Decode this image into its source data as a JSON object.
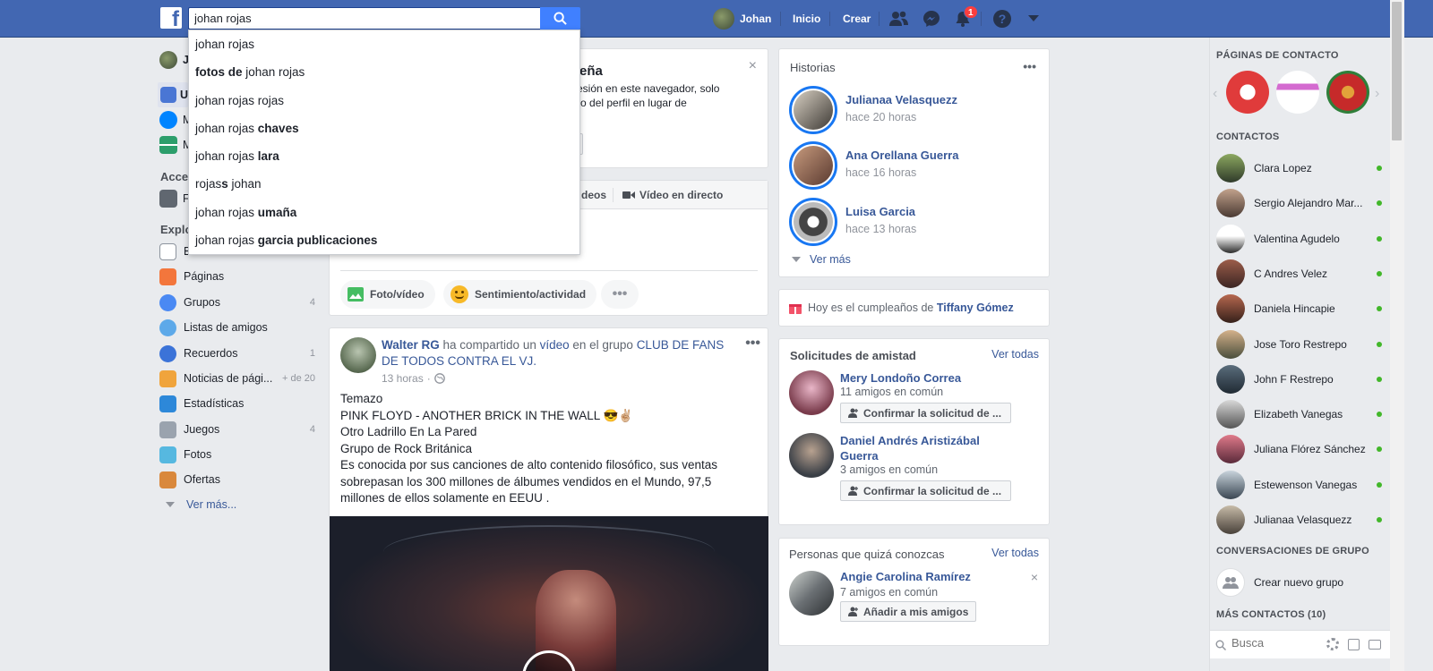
{
  "header": {
    "logo": "f",
    "search_value": "johan rojas",
    "user_name": "Johan",
    "home": "Inicio",
    "create": "Crear",
    "notif_count": "1"
  },
  "suggestions": [
    {
      "pre": "johan rojas",
      "bold": ""
    },
    {
      "pre": "",
      "bold": "fotos de",
      "post": " johan rojas"
    },
    {
      "pre": "johan rojas rojas",
      "bold": ""
    },
    {
      "pre": "johan rojas ",
      "bold": "chaves"
    },
    {
      "pre": "johan rojas ",
      "bold": "lara"
    },
    {
      "pre": "rojas",
      "bold": "s",
      "post": " johan"
    },
    {
      "pre": "johan rojas ",
      "bold": "umaña"
    },
    {
      "pre": "johan rojas ",
      "bold": "garcia publicaciones"
    }
  ],
  "left": {
    "user_initial": "J",
    "partial_u": "U",
    "partial_m1": "M",
    "partial_m2": "M",
    "shortcuts_head": "Acce",
    "partial_f": "F",
    "explore_head": "Explo",
    "items": [
      {
        "label": "Eventos",
        "count": ""
      },
      {
        "label": "Páginas",
        "count": ""
      },
      {
        "label": "Grupos",
        "count": "4"
      },
      {
        "label": "Listas de amigos",
        "count": ""
      },
      {
        "label": "Recuerdos",
        "count": "1"
      },
      {
        "label": "Noticias de pági...",
        "count": "+ de 20"
      },
      {
        "label": "Estadísticas",
        "count": ""
      },
      {
        "label": "Juegos",
        "count": "4"
      },
      {
        "label": "Fotos",
        "count": ""
      },
      {
        "label": "Ofertas",
        "count": ""
      }
    ],
    "see_more": "Ver más..."
  },
  "center": {
    "notice_title_tail": "eña",
    "notice_line1": "es sesión en este navegador, solo",
    "notice_line2": "la foto del perfil en lugar de",
    "notice_btn_tail": "no",
    "compose_tab_videos": "deos",
    "compose_tab_live": "Vídeo en directo",
    "photo_video": "Foto/vídeo",
    "feeling": "Sentimiento/actividad",
    "post": {
      "author": "Walter RG",
      "action": " ha compartido un ",
      "object": "vídeo",
      "in_group": " en el grupo ",
      "group": "CLUB DE FANS DE TODOS CONTRA EL VJ.",
      "time": "13 horas",
      "lines": [
        "Temazo",
        "PINK FLOYD - ANOTHER BRICK IN THE WALL 😎✌🏼",
        "Otro Ladrillo En La Pared",
        "Grupo de Rock Británica",
        "Es conocida por sus canciones de alto contenido filosófico, sus ventas sobrepasan los 300 millones de álbumes vendidos en el Mundo, 97,5 millones de ellos solamente en EEUU ."
      ]
    }
  },
  "right": {
    "stories_title": "Historias",
    "stories": [
      {
        "name": "Julianaa Velasquezz",
        "time": "hace 20 horas"
      },
      {
        "name": "Ana Orellana Guerra",
        "time": "hace 16 horas"
      },
      {
        "name": "Luisa Garcia",
        "time": "hace 13 horas"
      }
    ],
    "see_more": "Ver más",
    "birthday_pre": "Hoy es el cumpleaños de ",
    "birthday_name": "Tiffany Gómez",
    "requests_title": "Solicitudes de amistad",
    "see_all": "Ver todas",
    "requests": [
      {
        "name": "Mery Londoño Correa",
        "mutual": "11 amigos en común",
        "btn": "Confirmar la solicitud de ..."
      },
      {
        "name": "Daniel Andrés Aristizábal Guerra",
        "mutual": "3 amigos en común",
        "btn": "Confirmar la solicitud de ..."
      }
    ],
    "pymk_title": "Personas que quizá conozcas",
    "pymk": {
      "name": "Angie Carolina Ramírez",
      "mutual": "7 amigos en común",
      "btn": "Añadir a mis amigos"
    }
  },
  "chat": {
    "pages_head": "PÁGINAS DE CONTACTO",
    "contacts_head": "CONTACTOS",
    "contacts": [
      "Clara Lopez",
      "Sergio Alejandro Mar...",
      "Valentina Agudelo",
      "C Andres Velez",
      "Daniela Hincapie",
      "Jose Toro Restrepo",
      "John F Restrepo",
      "Elizabeth Vanegas",
      "Juliana Flórez Sánchez",
      "Estewenson Vanegas",
      "Julianaa Velasquezz"
    ],
    "groups_head": "CONVERSACIONES DE GRUPO",
    "create_group": "Crear nuevo grupo",
    "more_contacts": "MÁS CONTACTOS (10)",
    "search_placeholder": "Busca"
  }
}
